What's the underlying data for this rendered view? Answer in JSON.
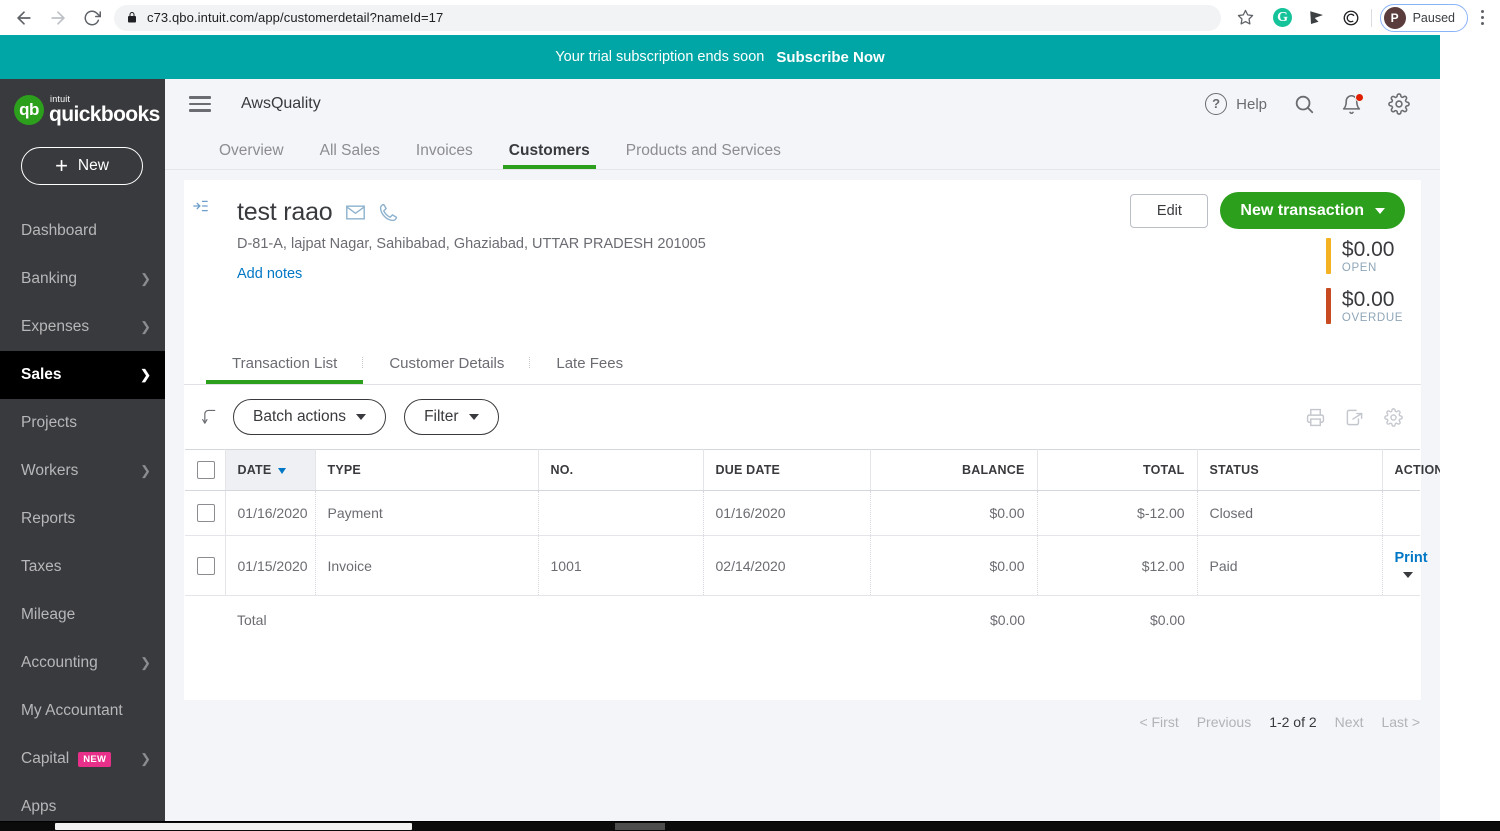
{
  "browser": {
    "url": "c73.qbo.intuit.com/app/customerdetail?nameId=17",
    "back_icon": "back-arrow-icon",
    "forward_icon": "forward-arrow-icon",
    "reload_icon": "reload-icon",
    "lock_icon": "lock-icon",
    "star_icon": "star-icon",
    "extensions": [
      "grammarly-icon",
      "pointer-icon",
      "spiral-icon"
    ],
    "grammarly_letter": "G",
    "profile_initial": "P",
    "profile_label": "Paused",
    "menu_icon": "kebab-menu-icon"
  },
  "trial_banner": {
    "message": "Your trial subscription ends soon",
    "cta": "Subscribe Now",
    "color": "#00a5a5"
  },
  "sidebar": {
    "logo": {
      "mark": "qb",
      "intuit": "intuit",
      "name": "quickbooks",
      "color": "#2ca01c"
    },
    "new_button": "New",
    "items": [
      {
        "label": "Dashboard",
        "chevron": false,
        "active": false
      },
      {
        "label": "Banking",
        "chevron": true,
        "active": false
      },
      {
        "label": "Expenses",
        "chevron": true,
        "active": false
      },
      {
        "label": "Sales",
        "chevron": true,
        "active": true
      },
      {
        "label": "Projects",
        "chevron": false,
        "active": false
      },
      {
        "label": "Workers",
        "chevron": true,
        "active": false
      },
      {
        "label": "Reports",
        "chevron": false,
        "active": false
      },
      {
        "label": "Taxes",
        "chevron": false,
        "active": false
      },
      {
        "label": "Mileage",
        "chevron": false,
        "active": false
      },
      {
        "label": "Accounting",
        "chevron": true,
        "active": false
      },
      {
        "label": "My Accountant",
        "chevron": false,
        "active": false
      },
      {
        "label": "Capital",
        "chevron": true,
        "active": false,
        "badge": "NEW"
      },
      {
        "label": "Apps",
        "chevron": false,
        "active": false
      }
    ]
  },
  "header": {
    "menu_icon": "hamburger-menu-icon",
    "company": "AwsQuality",
    "help_label": "Help",
    "help_icon": "question-mark-icon",
    "search_icon": "search-icon",
    "notifications_icon": "bell-icon",
    "settings_icon": "gear-icon"
  },
  "sales_tabs": [
    {
      "label": "Overview",
      "active": false
    },
    {
      "label": "All Sales",
      "active": false
    },
    {
      "label": "Invoices",
      "active": false
    },
    {
      "label": "Customers",
      "active": true
    },
    {
      "label": "Products and Services",
      "active": false
    }
  ],
  "customer": {
    "collapse_icon": "collapse-panel-icon",
    "name": "test raao",
    "email_icon": "envelope-icon",
    "phone_icon": "phone-icon",
    "address": "D-81-A, lajpat Nagar, Sahibabad, Ghaziabad, UTTAR PRADESH 201005",
    "add_notes": "Add notes",
    "edit_button": "Edit",
    "new_transaction_button": "New transaction",
    "open": {
      "amount": "$0.00",
      "label": "OPEN",
      "color": "#f4b223"
    },
    "overdue": {
      "amount": "$0.00",
      "label": "OVERDUE",
      "color": "#c74a20"
    }
  },
  "inner_tabs": [
    {
      "label": "Transaction List",
      "active": true
    },
    {
      "label": "Customer Details",
      "active": false
    },
    {
      "label": "Late Fees",
      "active": false
    }
  ],
  "toolbar": {
    "refresh_icon": "refresh-arrow-icon",
    "batch_actions": "Batch actions",
    "filter": "Filter",
    "print_icon": "printer-icon",
    "export_icon": "export-icon",
    "settings_icon": "gear-icon"
  },
  "table": {
    "columns": [
      {
        "key": "date",
        "label": "DATE",
        "align": "left",
        "sorted": true
      },
      {
        "key": "type",
        "label": "TYPE",
        "align": "left"
      },
      {
        "key": "no",
        "label": "NO.",
        "align": "left"
      },
      {
        "key": "due_date",
        "label": "DUE DATE",
        "align": "left"
      },
      {
        "key": "balance",
        "label": "BALANCE",
        "align": "right"
      },
      {
        "key": "total",
        "label": "TOTAL",
        "align": "right"
      },
      {
        "key": "status",
        "label": "STATUS",
        "align": "left"
      },
      {
        "key": "action",
        "label": "ACTION",
        "align": "right"
      }
    ],
    "rows": [
      {
        "date": "01/16/2020",
        "type": "Payment",
        "no": "",
        "due_date": "01/16/2020",
        "balance": "$0.00",
        "total": "$-12.00",
        "status": "Closed",
        "action": ""
      },
      {
        "date": "01/15/2020",
        "type": "Invoice",
        "no": "1001",
        "due_date": "02/14/2020",
        "balance": "$0.00",
        "total": "$12.00",
        "status": "Paid",
        "action": "Print"
      }
    ],
    "totals": {
      "label": "Total",
      "balance": "$0.00",
      "total": "$0.00"
    }
  },
  "pagination": {
    "first": "< First",
    "previous": "Previous",
    "current": "1-2 of 2",
    "next": "Next",
    "last": "Last >"
  }
}
